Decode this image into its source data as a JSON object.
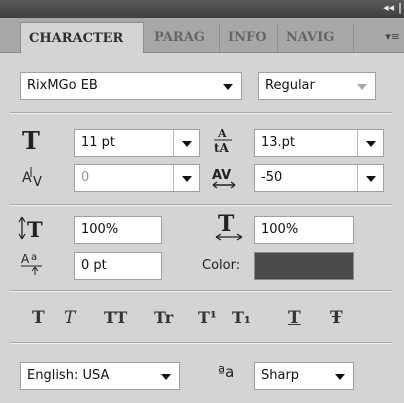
{
  "panel": {
    "collapse_glyph": "◂◂ |",
    "menu_glyph": "▾≡",
    "tabs": [
      {
        "label": "CHARACTER"
      },
      {
        "label": "PARAG"
      },
      {
        "label": "INFO"
      },
      {
        "label": "NAVIG"
      }
    ]
  },
  "font": {
    "family": "RixMGo EB",
    "style": "Regular"
  },
  "size": {
    "font_size": "11 pt",
    "leading": "13.pt"
  },
  "spacing": {
    "kerning": "0",
    "tracking": "-50"
  },
  "scale": {
    "vertical": "100%",
    "horizontal": "100%"
  },
  "baseline": {
    "shift": "0 pt",
    "color_label": "Color:",
    "color_value": "#4a4a4a"
  },
  "styles": [
    "T",
    "T",
    "TT",
    "Tr",
    "T¹",
    "T₁",
    "T",
    "Ŧ"
  ],
  "bottom": {
    "language": "English: USA",
    "aa_label": "ªa",
    "antialias": "Sharp"
  }
}
